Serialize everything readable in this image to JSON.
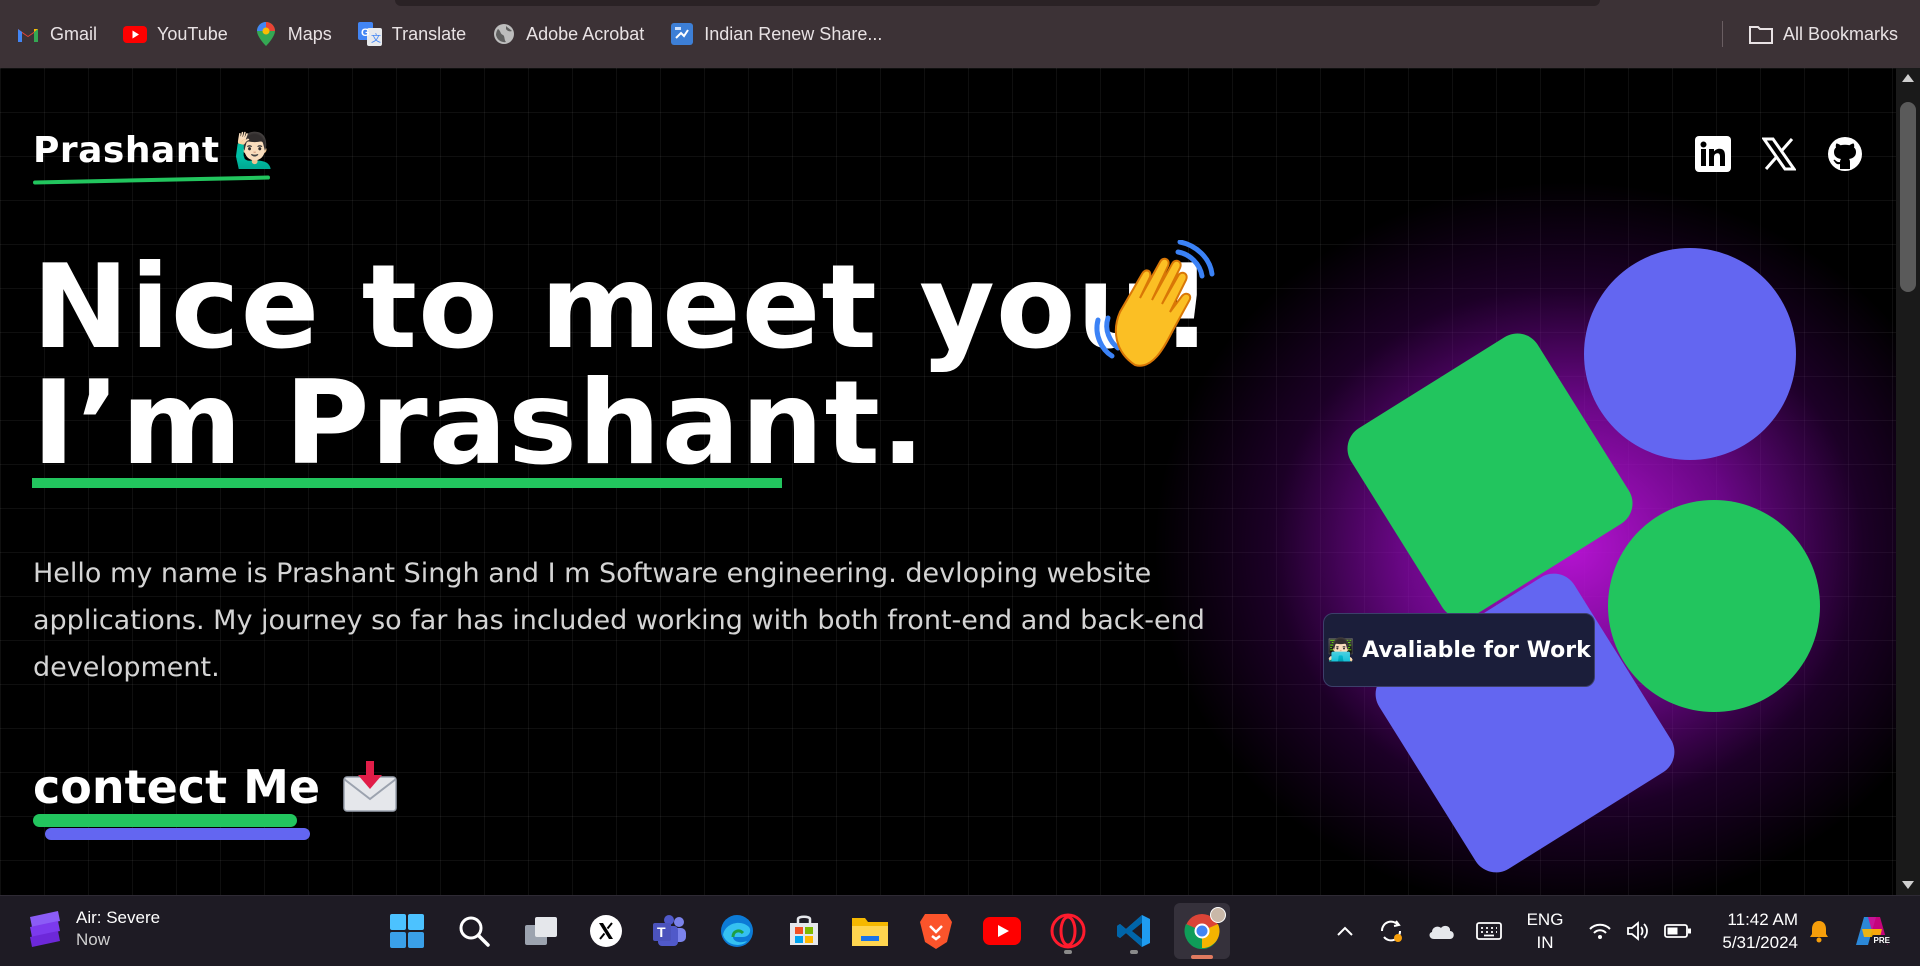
{
  "bookmarks": {
    "items": [
      {
        "label": "Gmail",
        "icon": "gmail-icon"
      },
      {
        "label": "YouTube",
        "icon": "youtube-icon"
      },
      {
        "label": "Maps",
        "icon": "maps-icon"
      },
      {
        "label": "Translate",
        "icon": "translate-icon"
      },
      {
        "label": "Adobe Acrobat",
        "icon": "globe-icon"
      },
      {
        "label": "Indian Renew Share...",
        "icon": "share-icon"
      }
    ],
    "all_label": "All Bookmarks"
  },
  "site": {
    "logo_text": "Prashant",
    "logo_emoji": "🙋🏻‍♂️",
    "heading_line1": "Nice to meet you!",
    "heading_line2": "I’m Prashant.",
    "description": "Hello my name is Prashant Singh and I m Software engineering. devloping website applications. My journey so far has included working with both front-end and back-end development.",
    "contact_label": "contect Me",
    "badge_label": "👨🏻‍💻 Avaliable for Work",
    "colors": {
      "green": "#22c55e",
      "blue": "#6366f1",
      "glow": "#c026d3"
    }
  },
  "taskbar": {
    "weather_title": "Air: Severe",
    "weather_sub": "Now",
    "lang_line1": "ENG",
    "lang_line2": "IN",
    "time": "11:42 AM",
    "date": "5/31/2024"
  }
}
